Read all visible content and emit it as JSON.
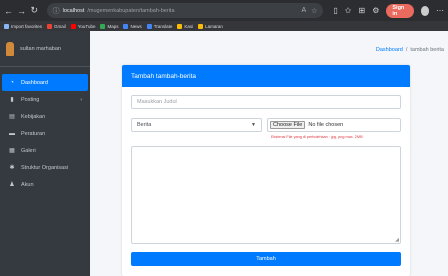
{
  "browser": {
    "url_host": "localhost",
    "url_path": "/mugemenkabupaten/tambah-berita",
    "profile_label": "Sign in",
    "back_icon": "arrow-left-icon",
    "forward_icon": "arrow-right-icon",
    "reload_icon": "reload-icon"
  },
  "bookmarks": [
    {
      "label": "Import favorites",
      "color": "#8ab4f8"
    },
    {
      "label": "Gmail",
      "color": "#ea4335"
    },
    {
      "label": "YouTube",
      "color": "#ff0000"
    },
    {
      "label": "Maps",
      "color": "#34a853"
    },
    {
      "label": "News",
      "color": "#4285f4"
    },
    {
      "label": "Translate",
      "color": "#4285f4"
    },
    {
      "label": "Kasi",
      "color": "#fbbc04"
    },
    {
      "label": "Lamaran",
      "color": "#fbbc04"
    }
  ],
  "sidebar": {
    "user_name": "sultan marhaban",
    "items": [
      {
        "label": "Dashboard",
        "icon": "dashboard-icon",
        "glyph": "◔",
        "active": true
      },
      {
        "label": "Posting",
        "icon": "file-icon",
        "glyph": "▮",
        "caret": "‹"
      },
      {
        "label": "Kebijakan",
        "icon": "book-icon",
        "glyph": "▤"
      },
      {
        "label": "Peraturan",
        "icon": "document-icon",
        "glyph": "▬"
      },
      {
        "label": "Galeri",
        "icon": "image-icon",
        "glyph": "▦"
      },
      {
        "label": "Struktur Organisasi",
        "icon": "users-icon",
        "glyph": "✱"
      },
      {
        "label": "Akun",
        "icon": "user-icon",
        "glyph": "♟"
      }
    ]
  },
  "breadcrumb": {
    "link": "Dashboard",
    "separator": "/",
    "current": "tambah berita"
  },
  "form": {
    "title": "Tambah tambah-berita",
    "judul_placeholder": "Masukkan Judul",
    "kategori_value": "Berita",
    "file_button": "Choose File",
    "file_status": "No file chosen",
    "file_hint": "Ekstensi File yang di perbolehkan : jpg, png max. 2MB",
    "submit_label": "Tambah"
  },
  "colors": {
    "primary": "#007bff",
    "sidebar_bg": "#343a40",
    "danger": "#dc3545"
  }
}
